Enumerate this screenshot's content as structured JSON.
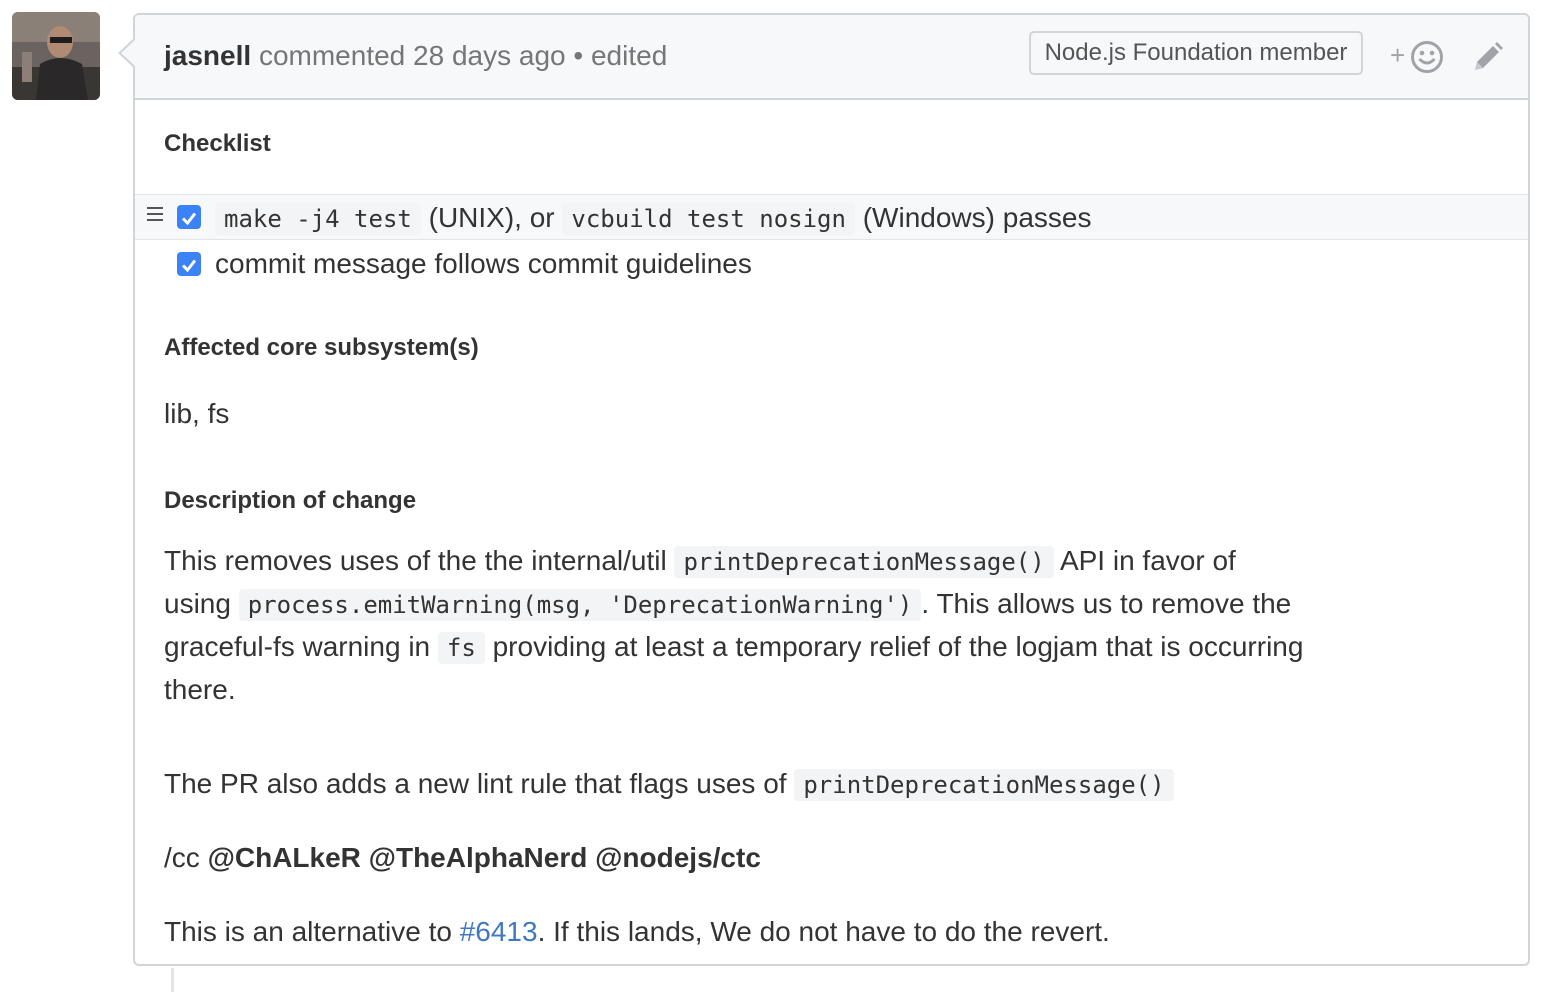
{
  "comment": {
    "author": "jasnell",
    "action": "commented",
    "time": "28 days ago",
    "separator": "•",
    "edited": "edited",
    "badge": "Node.js Foundation member",
    "reaction_plus": "+"
  },
  "body": {
    "checklist_heading": "Checklist",
    "tasks": [
      {
        "checked": true,
        "code1": "make -j4 test",
        "text1": "(UNIX), or",
        "code2": "vcbuild test nosign",
        "text2": "(Windows) passes"
      },
      {
        "checked": true,
        "text": "commit message follows commit guidelines"
      }
    ],
    "subsystem_heading": "Affected core subsystem(s)",
    "subsystem_text": "lib, fs",
    "description_heading": "Description of change",
    "description": {
      "t1": "This removes uses of the the internal/util",
      "c1": "printDeprecationMessage()",
      "t2": "API in favor of using",
      "c2": "process.emitWarning(msg, 'DeprecationWarning')",
      "t3": ". This allows us to remove the graceful-fs warning in",
      "c3": "fs",
      "t4": "providing at least a temporary relief of the logjam that is occurring there."
    },
    "lint": {
      "text": "The PR also adds a new lint rule that flags uses of",
      "code": "printDeprecationMessage()"
    },
    "cc": {
      "prefix": "/cc",
      "mentions": [
        "@ChALkeR",
        "@TheAlphaNerd",
        "@nodejs/ctc"
      ]
    },
    "alternative": {
      "t1": "This is an alternative to",
      "link": "#6413",
      "t2": ". If this lands, We do not have to do the revert."
    }
  },
  "icons": {
    "avatar": "user-avatar",
    "reaction": "smiley-icon",
    "edit": "pencil-icon",
    "drag": "drag-handle-icon",
    "check": "checkmark-icon"
  },
  "colors": {
    "link": "#4078c0",
    "checkbox": "#3b82f6",
    "header_bg": "#f6f8fa",
    "border": "#d1d5da"
  }
}
